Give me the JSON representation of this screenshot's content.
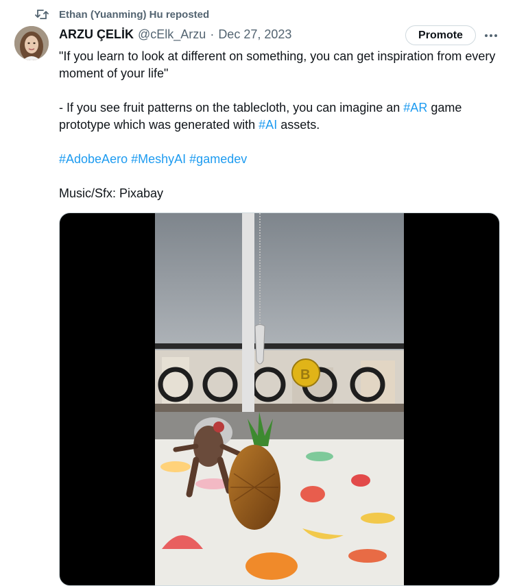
{
  "repost": {
    "icon": "repost-icon",
    "text": "Ethan (Yuanming) Hu reposted"
  },
  "tweet": {
    "author_name": "ARZU ÇELİK",
    "handle": "@cElk_Arzu",
    "separator": "·",
    "date": "Dec 27, 2023",
    "promote_label": "Promote",
    "more_icon": "more-icon",
    "quote": "\"If you learn to look at different on something, you can get inspiration from every moment of your life\"",
    "line2_part1": "- If you see fruit patterns on the tablecloth, you can imagine an ",
    "line2_tag1": "#AR",
    "line2_part2": " game prototype which was generated with ",
    "line2_tag2": "#AI",
    "line2_part3": " assets.",
    "hashtags": [
      "#AdobeAero",
      "#MeshyAI",
      "#gamedev"
    ],
    "credits": "Music/Sfx: Pixabay"
  },
  "colors": {
    "link": "#1d9bf0",
    "secondary_text": "#536471",
    "primary_text": "#0f1419"
  }
}
